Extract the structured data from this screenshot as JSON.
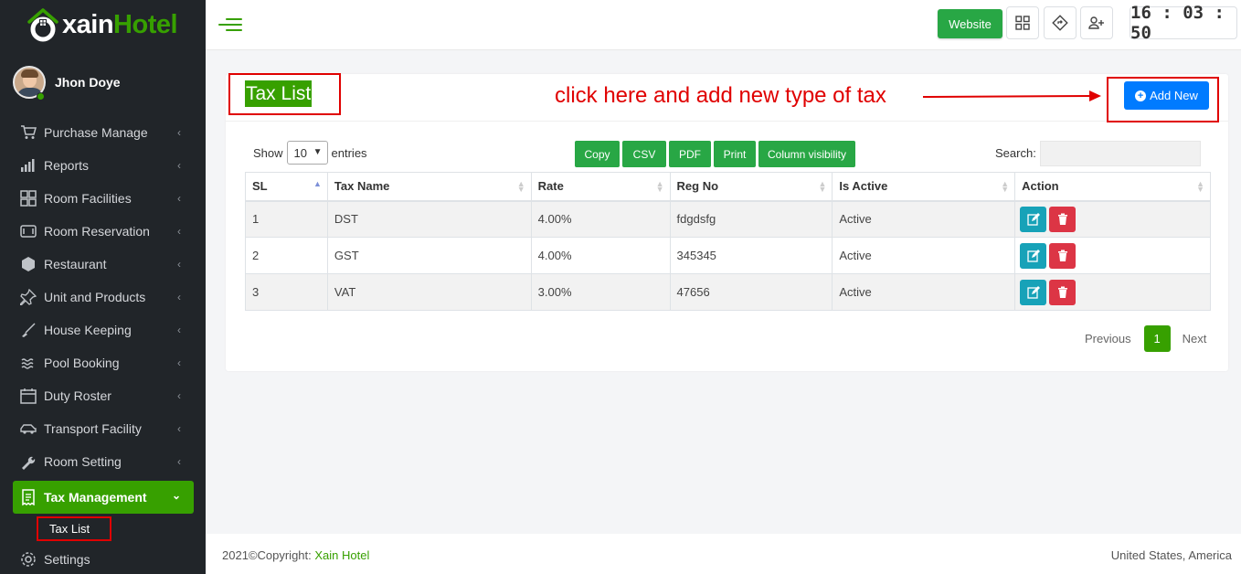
{
  "brand": {
    "logo_text_1": "xain",
    "logo_text_2": "Hotel"
  },
  "user": {
    "name": "Jhon Doye"
  },
  "sidebar": {
    "items": [
      {
        "label": "Purchase Manage",
        "icon": "cart-icon"
      },
      {
        "label": "Reports",
        "icon": "bar-chart-icon"
      },
      {
        "label": "Room Facilities",
        "icon": "grid-icon"
      },
      {
        "label": "Room Reservation",
        "icon": "reservation-icon"
      },
      {
        "label": "Restaurant",
        "icon": "restaurant-icon"
      },
      {
        "label": "Unit and Products",
        "icon": "pin-icon"
      },
      {
        "label": "House Keeping",
        "icon": "broom-icon"
      },
      {
        "label": "Pool Booking",
        "icon": "waves-icon"
      },
      {
        "label": "Duty Roster",
        "icon": "calendar-icon"
      },
      {
        "label": "Transport Facility",
        "icon": "car-icon"
      },
      {
        "label": "Room Setting",
        "icon": "wrench-icon"
      }
    ],
    "active": {
      "label": "Tax Management",
      "icon": "receipt-icon"
    },
    "sub_active": "Tax List",
    "settings": "Settings"
  },
  "topbar": {
    "website_label": "Website",
    "clock": "16 : 03 : 50"
  },
  "page": {
    "title": "Tax List",
    "annotation": "click here and add new type of tax",
    "add_new": "Add New"
  },
  "table_controls": {
    "show": "Show",
    "entries_value": "10",
    "entries": "entries",
    "buttons": [
      "Copy",
      "CSV",
      "PDF",
      "Print",
      "Column visibility"
    ],
    "search_label": "Search:"
  },
  "table": {
    "headers": [
      "SL",
      "Tax Name",
      "Rate",
      "Reg No",
      "Is Active",
      "Action"
    ],
    "rows": [
      [
        "1",
        "DST",
        "4.00%",
        "fdgdsfg",
        "Active"
      ],
      [
        "2",
        "GST",
        "4.00%",
        "345345",
        "Active"
      ],
      [
        "3",
        "VAT",
        "3.00%",
        "47656",
        "Active"
      ]
    ]
  },
  "pagination": {
    "previous": "Previous",
    "page": "1",
    "next": "Next"
  },
  "footer": {
    "copyright": "2021©Copyright: ",
    "brand": "Xain Hotel",
    "location": "United States, America"
  },
  "colors": {
    "brand_green": "#37a000",
    "primary_blue": "#007bff",
    "annotation_red": "#e00000",
    "sidebar_bg": "#212529"
  }
}
